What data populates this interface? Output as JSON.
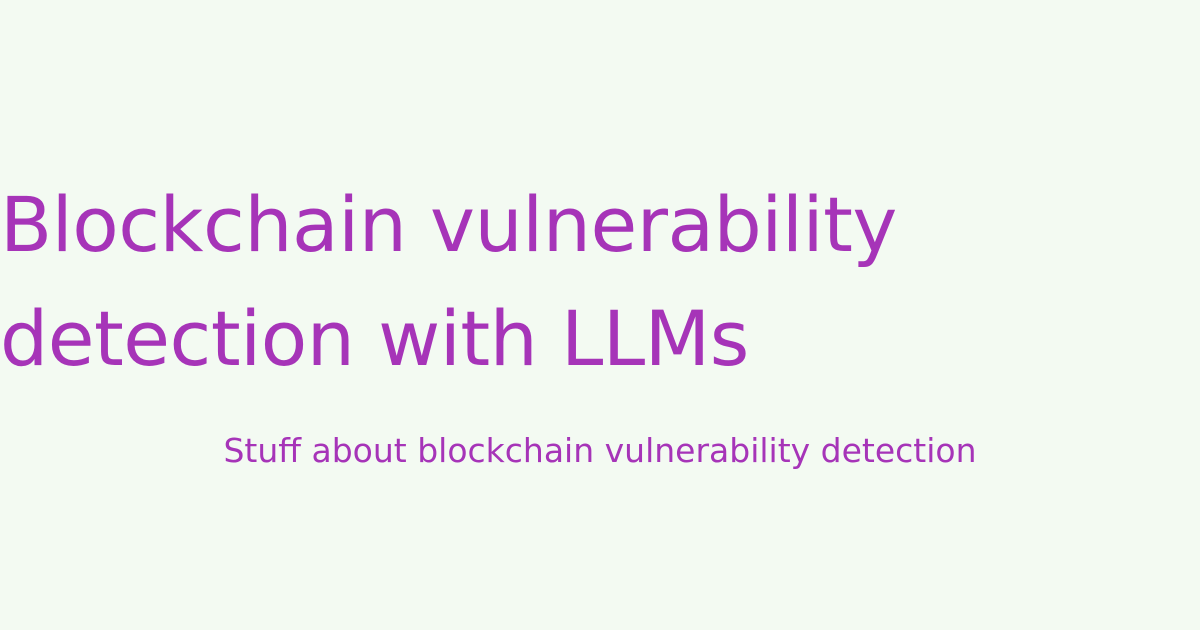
{
  "card": {
    "title_lines": [
      "Blockchain vulnerability",
      "detection with LLMs"
    ],
    "subtitle": "Stuff about blockchain vulnerability detection"
  },
  "colors": {
    "background": "#f3faf2",
    "text": "#a634b8"
  }
}
